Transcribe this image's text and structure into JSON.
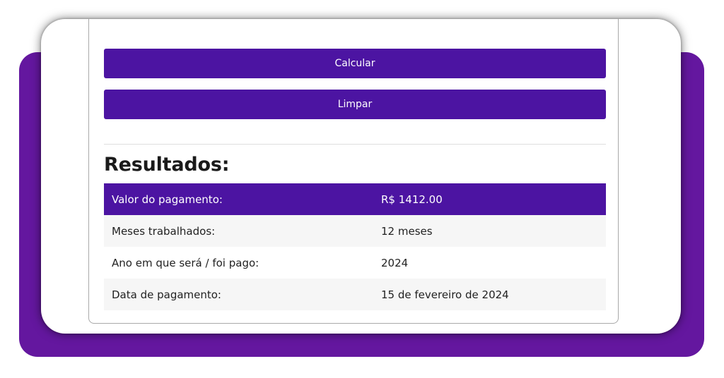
{
  "buttons": {
    "calculate_label": "Calcular",
    "clear_label": "Limpar"
  },
  "results": {
    "title": "Resultados:",
    "rows": [
      {
        "label": "Valor do pagamento:",
        "value": "R$ 1412.00"
      },
      {
        "label": "Meses trabalhados:",
        "value": "12 meses"
      },
      {
        "label": "Ano em que será / foi pago:",
        "value": "2024"
      },
      {
        "label": "Data de pagamento:",
        "value": "15 de fevereiro de 2024"
      }
    ]
  },
  "colors": {
    "accent": "#4c14a2",
    "backdrop": "#64179f"
  }
}
